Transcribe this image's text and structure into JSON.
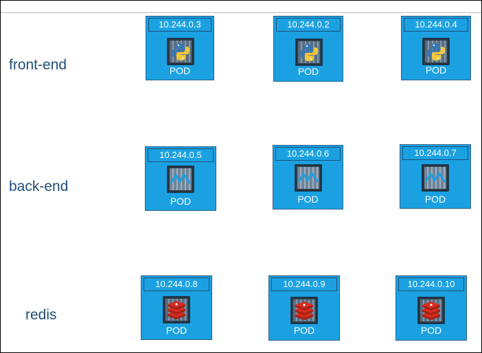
{
  "colors": {
    "pod_fill": "#1ba1e2",
    "pod_border": "#2f5f86",
    "label_text": "#1f4e79",
    "container_frame": "#2d3a48"
  },
  "rows": [
    {
      "label": "front-end",
      "icon": "python-container-icon",
      "pods": [
        {
          "ip": "10.244.0.3",
          "label": "POD"
        },
        {
          "ip": "10.244.0.2",
          "label": "POD"
        },
        {
          "ip": "10.244.0.4",
          "label": "POD"
        }
      ]
    },
    {
      "label": "back-end",
      "icon": "backend-container-icon",
      "pods": [
        {
          "ip": "10.244.0.5",
          "label": "POD"
        },
        {
          "ip": "10.244.0.6",
          "label": "POD"
        },
        {
          "ip": "10.244.0.7",
          "label": "POD"
        }
      ]
    },
    {
      "label": "redis",
      "icon": "redis-container-icon",
      "pods": [
        {
          "ip": "10.244.0.8",
          "label": "POD"
        },
        {
          "ip": "10.244.0.9",
          "label": "POD"
        },
        {
          "ip": "10.244.0.10",
          "label": "POD"
        }
      ]
    }
  ]
}
